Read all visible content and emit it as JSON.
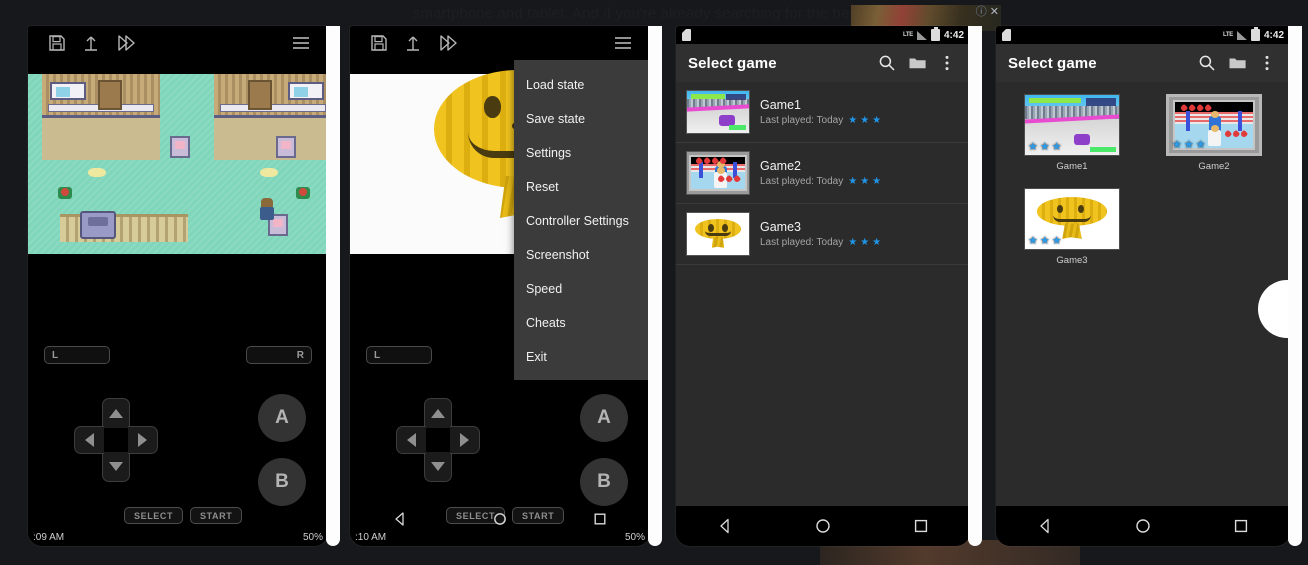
{
  "background": {
    "article_text": "smartphone and tablet. And if you're already searching for the best one,",
    "ad_info_icon": "info-icon",
    "ad_close_icon": "close-icon"
  },
  "panel1": {
    "label": "emulator-running",
    "toolbar": {
      "save_icon": "floppy-save-icon",
      "load_icon": "upload-arrow-icon",
      "fastforward_icon": "fast-forward-icon",
      "menu_icon": "hamburger-menu-icon"
    },
    "gamepad": {
      "l": "L",
      "r": "R",
      "a": "A",
      "b": "B",
      "select": "SELECT",
      "start": "START",
      "dpad_up": "dpad-up",
      "dpad_down": "dpad-down",
      "dpad_left": "dpad-left",
      "dpad_right": "dpad-right"
    },
    "status": {
      "time": ":09 AM",
      "battery": "50%"
    }
  },
  "panel2": {
    "label": "emulator-menu-open",
    "toolbar": {
      "save_icon": "floppy-save-icon",
      "load_icon": "upload-arrow-icon",
      "fastforward_icon": "fast-forward-icon",
      "menu_icon": "hamburger-menu-icon"
    },
    "menu_items": [
      "Load state",
      "Save state",
      "Settings",
      "Reset",
      "Controller Settings",
      "Screenshot",
      "Speed",
      "Cheats",
      "Exit"
    ],
    "gamepad": {
      "l": "L",
      "select": "SELECT",
      "start": "START",
      "a": "A",
      "b": "B"
    },
    "status": {
      "time": ":10 AM",
      "battery": "50%"
    },
    "navbar": {
      "back": "back-icon",
      "home": "home-icon",
      "recents": "recents-icon"
    }
  },
  "panel3": {
    "label": "game-list-view",
    "statusbar": {
      "time": "4:42",
      "network": "LTE",
      "sim_icon": "sim-card-icon",
      "battery_icon": "battery-icon"
    },
    "appbar": {
      "title": "Select game",
      "search_icon": "search-icon",
      "folder_icon": "folder-icon",
      "overflow_icon": "overflow-menu-icon"
    },
    "games": [
      {
        "name": "Game1",
        "subtitle": "Last played: Today",
        "stars": 3,
        "art": "race"
      },
      {
        "name": "Game2",
        "subtitle": "Last played: Today",
        "stars": 3,
        "art": "box"
      },
      {
        "name": "Game3",
        "subtitle": "Last played: Today",
        "stars": 3,
        "art": "pump"
      }
    ],
    "navbar": {
      "back": "back-icon",
      "home": "home-icon",
      "recents": "recents-icon"
    }
  },
  "panel4": {
    "label": "game-grid-view",
    "statusbar": {
      "time": "4:42",
      "network": "LTE",
      "sim_icon": "sim-card-icon",
      "battery_icon": "battery-icon"
    },
    "appbar": {
      "title": "Select game",
      "search_icon": "search-icon",
      "folder_icon": "folder-icon",
      "overflow_icon": "overflow-menu-icon"
    },
    "games": [
      {
        "name": "Game1",
        "stars": 3,
        "art": "race",
        "selected": false
      },
      {
        "name": "Game2",
        "stars": 3,
        "art": "box",
        "selected": true
      },
      {
        "name": "Game3",
        "stars": 3,
        "art": "pump",
        "selected": false
      }
    ],
    "navbar": {
      "back": "back-icon",
      "home": "home-icon",
      "recents": "recents-icon"
    }
  },
  "colors": {
    "accent_star": "#2196e8",
    "appbar_bg": "#303030",
    "app_bg": "#2b2b2b",
    "menu_bg": "#3b3b3b"
  }
}
